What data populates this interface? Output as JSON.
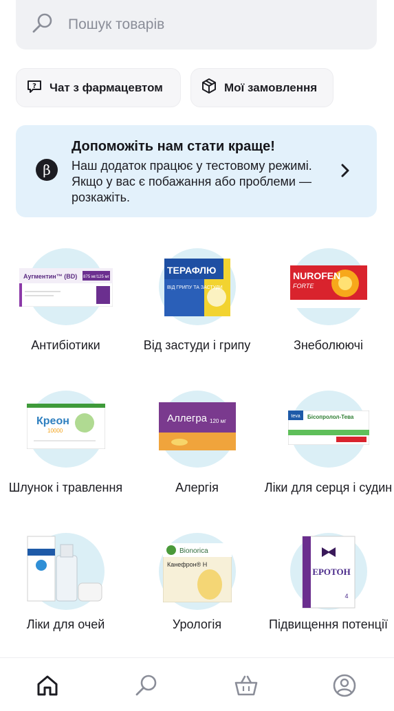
{
  "search": {
    "placeholder": "Пошук товарів"
  },
  "chips": {
    "chat": "Чат з фармацевтом",
    "orders": "Мої замовлення"
  },
  "banner": {
    "badge": "β",
    "title": "Допоможіть нам стати краще!",
    "text": "Наш додаток працює у тестовому режимі. Якщо у вас є побажання або проблеми — розкажіть."
  },
  "categories": [
    {
      "label": "Антибіотики",
      "product": "Аугментин™ (BD)",
      "product_sub": "875 мг/125 мг"
    },
    {
      "label": "Від застуди і грипу",
      "product": "ТЕРАФЛЮ",
      "product_sub": "ВІД ГРИПУ ТА ЗАСТУДИ"
    },
    {
      "label": "Знеболюючі",
      "product": "NUROFEN",
      "product_sub": "FORTE"
    },
    {
      "label": "Шлунок і травлення",
      "product": "Креон",
      "product_sub": "10000"
    },
    {
      "label": "Алергія",
      "product": "Аллегра",
      "product_sub": "120 мг"
    },
    {
      "label": "Ліки для серця і судин",
      "product": "Бісопролол-Тева",
      "product_sub": "teva"
    },
    {
      "label": "Ліки для очей",
      "product": "",
      "product_sub": ""
    },
    {
      "label": "Урологія",
      "product": "Канефрон® Н",
      "product_sub": "Bionorica"
    },
    {
      "label": "Підвищення потенції",
      "product": "ЕРОТОН",
      "product_sub": "4"
    }
  ],
  "colors": {
    "accent_bg": "#e3f1fb",
    "circle": "#dbeff6",
    "field": "#f0f1f4"
  },
  "icons": [
    "search-icon",
    "chat-question-icon",
    "box-icon",
    "chevron-right-icon",
    "home-icon",
    "search-tab-icon",
    "basket-icon",
    "profile-icon"
  ]
}
